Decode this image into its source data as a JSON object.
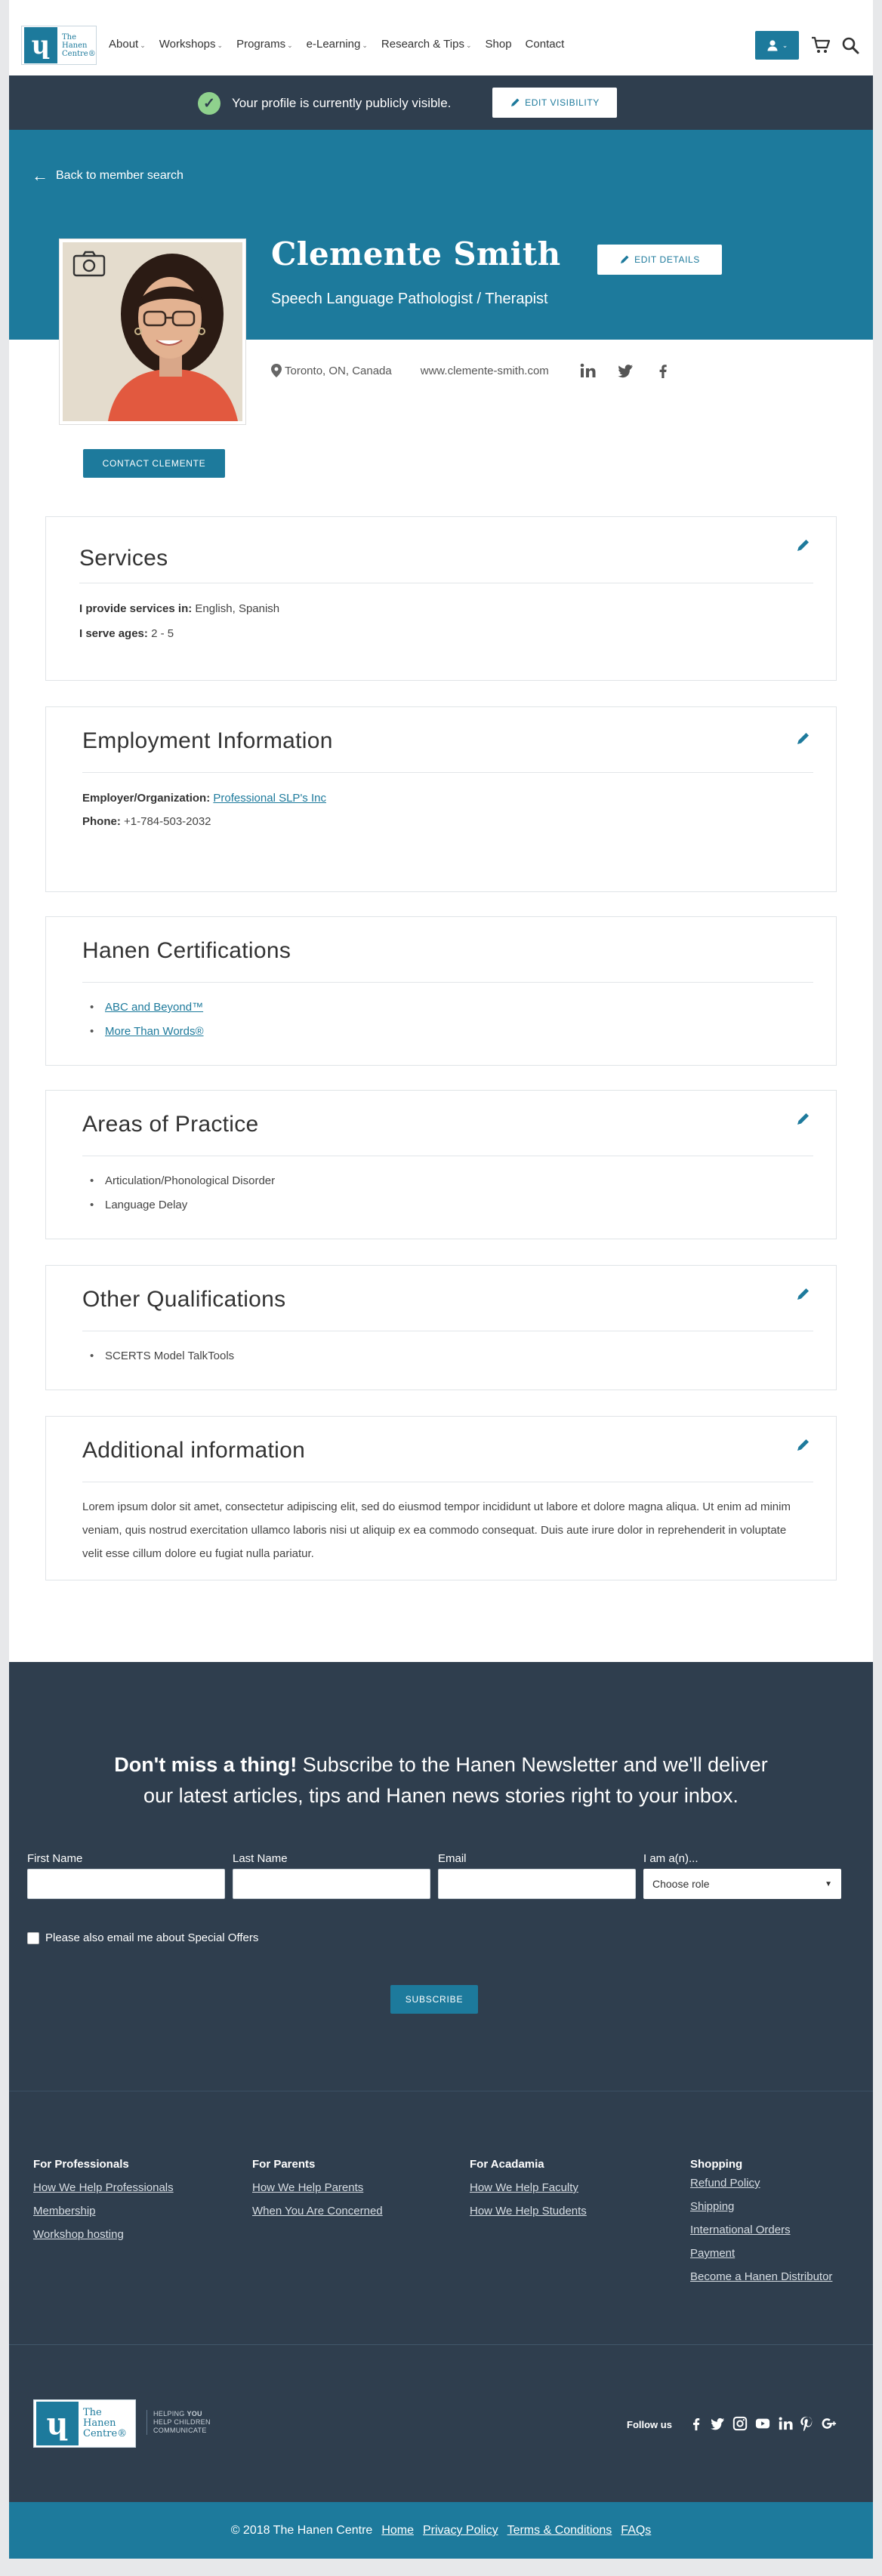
{
  "header": {
    "logo_text": [
      "The",
      "Hanen",
      "Centre®"
    ],
    "nav": [
      {
        "label": "About",
        "caret": true
      },
      {
        "label": "Workshops",
        "caret": true
      },
      {
        "label": "Programs",
        "caret": true
      },
      {
        "label": "e-Learning",
        "caret": true
      },
      {
        "label": "Research & Tips",
        "caret": true
      },
      {
        "label": "Shop",
        "caret": false
      },
      {
        "label": "Contact",
        "caret": false
      }
    ],
    "user_icon": "user-icon",
    "cart_icon": "cart-icon",
    "search_icon": "search-icon"
  },
  "visibility": {
    "message": "Your profile is currently publicly visible.",
    "button": "EDIT VISIBILITY"
  },
  "profile": {
    "back_link": "Back to member search",
    "name": "Clemente Smith",
    "title": "Speech Language Pathologist / Therapist",
    "edit_button": "EDIT DETAILS",
    "location": "Toronto, ON, Canada",
    "website": "www.clemente-smith.com",
    "social": [
      "linkedin-icon",
      "twitter-icon",
      "facebook-icon"
    ],
    "contact_button": "CONTACT CLEMENTE"
  },
  "services": {
    "title": "Services",
    "languages_label": "I provide services in:",
    "languages": "English, Spanish",
    "ages_label": "I serve ages:",
    "ages": "2 - 5"
  },
  "employment": {
    "title": "Employment Information",
    "employer_label": "Employer/Organization:",
    "employer": "Professional SLP's Inc",
    "phone_label": "Phone:",
    "phone": "+1-784-503-2032"
  },
  "certifications": {
    "title": "Hanen Certifications",
    "items": [
      "ABC and Beyond™",
      "More Than Words®"
    ]
  },
  "practice": {
    "title": "Areas of Practice",
    "items": [
      "Articulation/Phonological Disorder",
      "Language Delay"
    ]
  },
  "qualifications": {
    "title": "Other Qualifications",
    "items": [
      "SCERTS Model TalkTools"
    ]
  },
  "additional": {
    "title": "Additional information",
    "text": "Lorem ipsum dolor sit amet, consectetur adipiscing elit, sed do eiusmod tempor incididunt ut labore et dolore magna aliqua. Ut enim ad minim veniam, quis nostrud exercitation ullamco laboris nisi ut aliquip ex ea commodo consequat. Duis aute irure dolor in reprehenderit in voluptate velit esse cillum dolore eu fugiat nulla pariatur."
  },
  "newsletter": {
    "headline_bold": "Don't miss a thing!",
    "headline_rest": " Subscribe to the Hanen Newsletter and we'll deliver our latest articles, tips and Hanen news stories right to your inbox.",
    "first_name": "First Name",
    "last_name": "Last Name",
    "email": "Email",
    "role_label": "I am a(n)...",
    "role_value": "Choose role",
    "offers": "Please also email me about Special Offers",
    "subscribe": "SUBSCRIBE"
  },
  "footer": {
    "columns": [
      {
        "title": "For Professionals",
        "links": [
          "How We Help Professionals",
          "Membership",
          "Workshop hosting"
        ]
      },
      {
        "title": "For Parents",
        "links": [
          "How We Help Parents",
          "When You Are Concerned"
        ]
      },
      {
        "title": "For Acadamia",
        "links": [
          "How We Help Faculty",
          "How We Help Students"
        ]
      },
      {
        "title": "Shopping",
        "links": [
          "Refund Policy",
          "Shipping",
          "International Orders",
          "Payment",
          "Become a Hanen Distributor"
        ]
      }
    ],
    "tagline": [
      "HELPING",
      "YOU",
      "HELP CHILDREN",
      "COMMUNICATE"
    ],
    "follow": "Follow us",
    "social": [
      "facebook-icon",
      "twitter-icon",
      "instagram-icon",
      "youtube-icon",
      "linkedin-icon",
      "pinterest-icon",
      "googleplus-icon"
    ]
  },
  "bottom": {
    "copyright": "© 2018 The Hanen Centre",
    "links": [
      "Home",
      "Privacy Policy",
      "Terms & Conditions",
      "FAQs"
    ]
  },
  "colors": {
    "brand": "#1d7a9c",
    "dark": "#2f3e4e",
    "success": "#8fd18d"
  }
}
